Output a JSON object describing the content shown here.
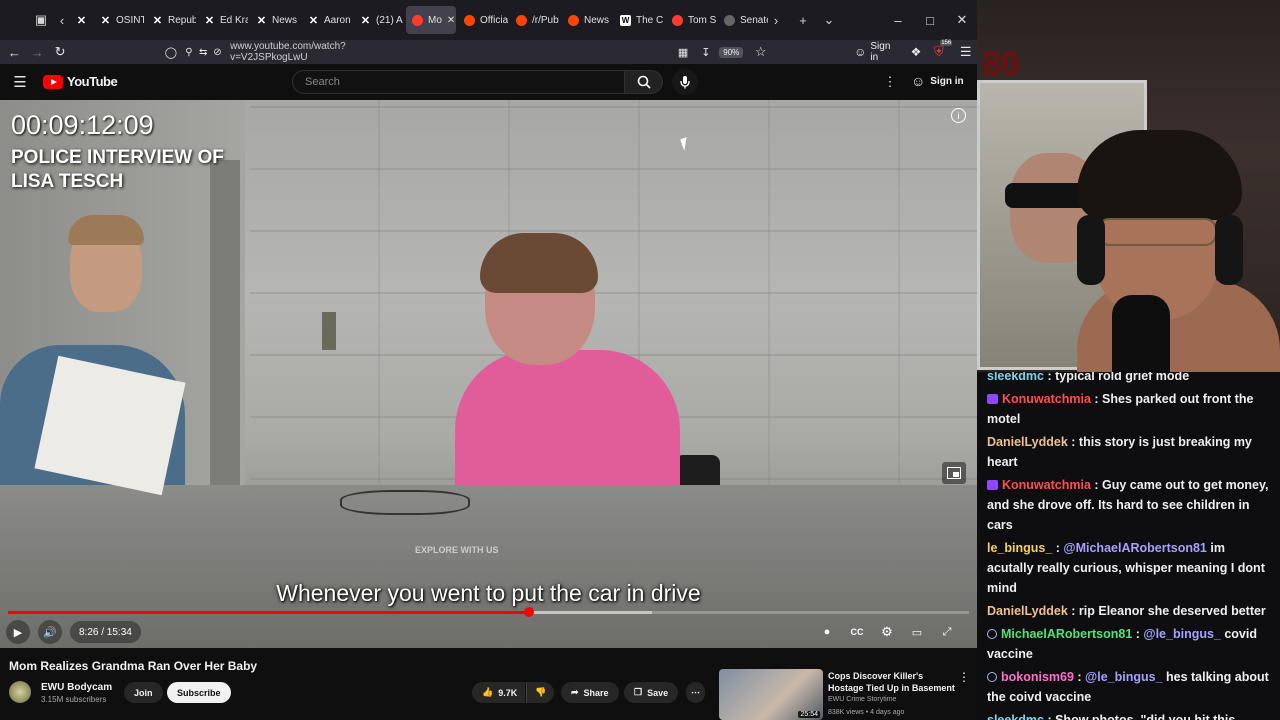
{
  "browser": {
    "tabs": [
      {
        "label": "X",
        "icon": "x"
      },
      {
        "label": "OSINT",
        "icon": "x"
      },
      {
        "label": "Repub",
        "icon": "x"
      },
      {
        "label": "Ed Kra",
        "icon": "x"
      },
      {
        "label": "News",
        "icon": "x"
      },
      {
        "label": "Aaron",
        "icon": "x"
      },
      {
        "label": "(21) A",
        "icon": "x"
      },
      {
        "label": "Mo",
        "icon": "youtube",
        "active": true
      },
      {
        "label": "Officia",
        "icon": "reddit"
      },
      {
        "label": "/r/Pub",
        "icon": "reddit"
      },
      {
        "label": "News",
        "icon": "reddit"
      },
      {
        "label": "The C",
        "icon": "w"
      },
      {
        "label": "Tom S",
        "icon": "youtube"
      },
      {
        "label": "Senate",
        "icon": "grey"
      }
    ],
    "url": "www.youtube.com/watch?v=V2JSPkogLwU",
    "zoom": "90%",
    "signin_label": "Sign in",
    "notification_count": "156"
  },
  "youtube": {
    "logo_text": "YouTube",
    "search_placeholder": "Search",
    "signin_label": "Sign in"
  },
  "video": {
    "timecode": "00:09:12:09",
    "overlay_title": "POLICE INTERVIEW OF LISA TESCH",
    "caption": "Whenever you went to put the car in drive",
    "watermark": "EXPLORE WITH US",
    "time_display": "8:26 / 15:34",
    "progress_played": 0.542,
    "progress_loaded": 0.67
  },
  "meta": {
    "title": "Mom Realizes Grandma Ran Over Her Baby",
    "channel": "EWU Bodycam",
    "subscribers": "3.15M subscribers",
    "join_label": "Join",
    "subscribe_label": "Subscribe",
    "likes": "9.7K",
    "share_label": "Share",
    "save_label": "Save"
  },
  "recommended": {
    "title": "Cops Discover Killer's Hostage Tied Up in Basement",
    "channel": "EWU Crime Storytime",
    "meta": "838K views • 4 days ago",
    "duration": "25:54"
  },
  "webcam": {
    "neon_text": "80"
  },
  "chat": [
    {
      "user": "sleekdmc",
      "color": "#7fd4ef",
      "badge": "",
      "text": " : typical rold grief mode",
      "first": true
    },
    {
      "user": "Konuwatchmia",
      "color": "#ff4f4f",
      "badge": "prime",
      "text": " : Shes parked out front the motel"
    },
    {
      "user": "DanielLyddek",
      "color": "#f0c28a",
      "badge": "",
      "text": " : this story is just breaking my heart"
    },
    {
      "user": "Konuwatchmia",
      "color": "#ff4f4f",
      "badge": "prime",
      "text": " : Guy came out to get money, and she drove off. Its hard to see children in cars"
    },
    {
      "user": "le_bingus_",
      "color": "#f6d34f",
      "badge": "",
      "text": " : ",
      "mention": "@MichaelARobertson81",
      "text2": " im acutally really curious, whisper meaning I dont mind"
    },
    {
      "user": "DanielLyddek",
      "color": "#f0c28a",
      "badge": "",
      "text": " : rip Eleanor she deserved better"
    },
    {
      "user": "MichaelARobertson81",
      "color": "#4ee27a",
      "badge": "person",
      "text": " : ",
      "mention": "@le_bingus_",
      "text2": " covid vaccine"
    },
    {
      "user": "bokonism69",
      "color": "#ff6ed0",
      "badge": "person",
      "text": " : ",
      "mention": "@le_bingus_",
      "text2": " hes talking about the coivd vaccine"
    },
    {
      "user": "sleekdmc",
      "color": "#7fd4ef",
      "badge": "",
      "text": " : Show photos, \"did you hit this person\" ??"
    }
  ]
}
